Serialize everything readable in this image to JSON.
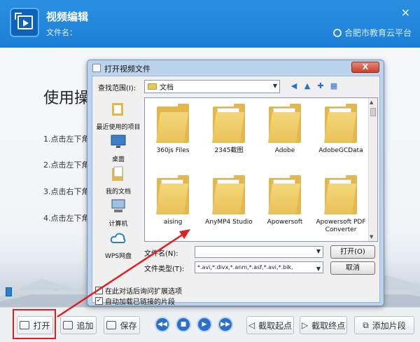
{
  "app": {
    "title": "视频编辑",
    "filename_label": "文件名：",
    "close_glyph": "×",
    "brand": "合肥市教育云平台"
  },
  "guide": {
    "title": "使用操",
    "steps": [
      "1.点击左下角",
      "2.点击左下角",
      "3.点击右下角",
      "4.点击左下角"
    ]
  },
  "toolbar": {
    "open_label": "打开",
    "add_label": "追加",
    "save_label": "保存",
    "mark_start_label": "截取起点",
    "mark_end_label": "截取终点",
    "clip_label": "添加片段"
  },
  "dialog": {
    "title": "打开视频文件",
    "close_glyph": "X",
    "lookin_label": "查找范围(I):",
    "lookin_value": "文档",
    "places": [
      "最近使用的项目",
      "桌面",
      "我的文档",
      "计算机",
      "WPS网盘"
    ],
    "folders": [
      "360js Files",
      "2345截图",
      "Adobe",
      "AdobeGCData",
      "aising",
      "AnyMP4 Studio",
      "Apowersoft",
      "Apowersoft PDF Converter"
    ],
    "filename_label": "文件名(N):",
    "filename_value": "",
    "filetype_label": "文件类型(T):",
    "filetype_value": "*.avi,*.divx,*.anm,*.asf,*.avi,*.bik,",
    "open_button": "打开(O)",
    "cancel_button": "取消",
    "check1_label": "在此对话后询问扩展选项",
    "check1_checked": false,
    "check2_label": "自动加载已链接的片段",
    "check2_checked": true
  },
  "colors": {
    "header_blue": "#1c7fd6",
    "highlight_red": "#e02020",
    "play_button_blue": "#2a6fc9"
  }
}
